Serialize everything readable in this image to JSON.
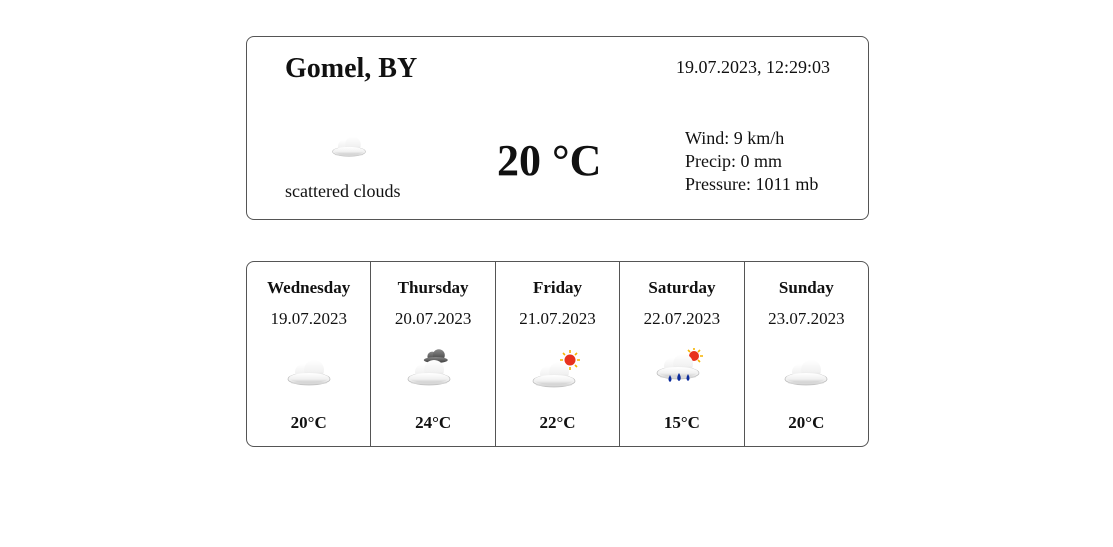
{
  "current": {
    "city": "Gomel, BY",
    "datetime": "19.07.2023, 12:29:03",
    "icon": "scattered-clouds-icon",
    "description": "scattered clouds",
    "temperature": "20 °C",
    "wind": "Wind: 9 km/h",
    "precip": "Precip: 0 mm",
    "pressure": "Pressure: 1011 mb"
  },
  "forecast": [
    {
      "day": "Wednesday",
      "date": "19.07.2023",
      "icon": "cloud-icon",
      "temp": "20°C"
    },
    {
      "day": "Thursday",
      "date": "20.07.2023",
      "icon": "broken-clouds-icon",
      "temp": "24°C"
    },
    {
      "day": "Friday",
      "date": "21.07.2023",
      "icon": "partly-sunny-icon",
      "temp": "22°C"
    },
    {
      "day": "Saturday",
      "date": "22.07.2023",
      "icon": "sun-rain-icon",
      "temp": "15°C"
    },
    {
      "day": "Sunday",
      "date": "23.07.2023",
      "icon": "cloud-icon",
      "temp": "20°C"
    }
  ]
}
